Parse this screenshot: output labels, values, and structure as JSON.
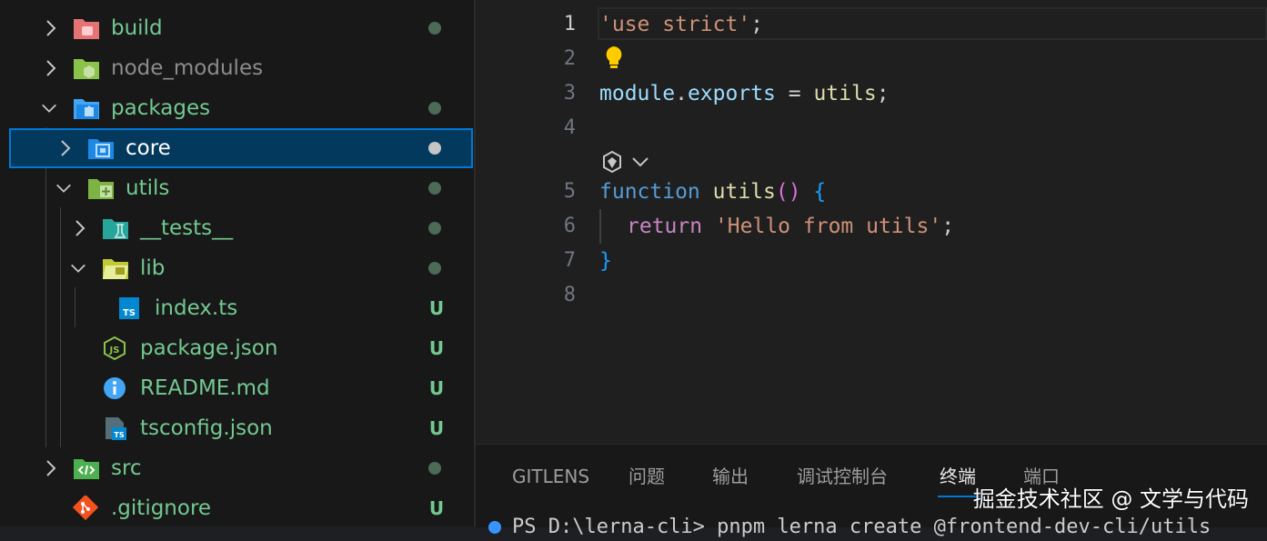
{
  "explorer": {
    "items": [
      {
        "label": "build",
        "status": "dot",
        "color": "#73c991"
      },
      {
        "label": "node_modules",
        "status": "",
        "color": "#8c8c8c"
      },
      {
        "label": "packages",
        "status": "dot",
        "color": "#73c991"
      },
      {
        "label": "core",
        "status": "dot",
        "color": "#ffffff"
      },
      {
        "label": "utils",
        "status": "dot",
        "color": "#73c991"
      },
      {
        "label": "__tests__",
        "status": "dot",
        "color": "#73c991"
      },
      {
        "label": "lib",
        "status": "dot",
        "color": "#73c991"
      },
      {
        "label": "index.ts",
        "status": "U",
        "color": "#73c991"
      },
      {
        "label": "package.json",
        "status": "U",
        "color": "#73c991"
      },
      {
        "label": "README.md",
        "status": "U",
        "color": "#73c991"
      },
      {
        "label": "tsconfig.json",
        "status": "U",
        "color": "#73c991"
      },
      {
        "label": "src",
        "status": "dot",
        "color": "#73c991"
      },
      {
        "label": ".gitignore",
        "status": "U",
        "color": "#73c991"
      }
    ]
  },
  "editor": {
    "line_numbers": [
      "1",
      "2",
      "3",
      "4",
      "5",
      "6",
      "7",
      "8"
    ],
    "code": {
      "l1_str": "'use strict'",
      "l1_semi": ";",
      "l3_obj": "module",
      "l3_dot": ".",
      "l3_prop": "exports",
      "l3_eq": " = ",
      "l3_val": "utils",
      "l3_semi": ";",
      "l5_kw": "function",
      "l5_name": " utils",
      "l5_paren": "()",
      "l5_brace": " {",
      "l6_kw": "return",
      "l6_str": " 'Hello from utils'",
      "l6_semi": ";",
      "l7_brace": "}"
    }
  },
  "panel": {
    "tabs": [
      "GITLENS",
      "问题",
      "输出",
      "调试控制台",
      "终端",
      "端口"
    ],
    "active_tab": "终端",
    "watermark": "掘金技术社区 @ 文学与代码",
    "terminal_line": "PS D:\\lerna-cli> pnpm lerna create @frontend-dev-cli/utils"
  }
}
